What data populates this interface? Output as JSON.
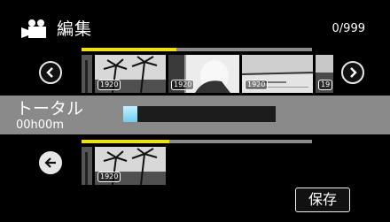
{
  "header": {
    "icon": "movie-camera-icon",
    "title": "編集",
    "counter": "0/999"
  },
  "top_rail": {
    "progress": 0.41
  },
  "top_strip": {
    "thumbnails": [
      {
        "badge": "1920",
        "scene": "palm-trees"
      },
      {
        "badge": "1920",
        "scene": "person"
      },
      {
        "badge": "1920",
        "scene": "lake"
      },
      {
        "badge": "19",
        "scene": "partial"
      }
    ]
  },
  "nav": {
    "prev_icon": "chevron-left-icon",
    "next_icon": "chevron-right-icon"
  },
  "total": {
    "label": "トータル",
    "time": "00h00m",
    "marker_fill": 0.0
  },
  "bottom_rail": {
    "progress": 0.38
  },
  "bottom_strip": {
    "back_icon": "back-arrow-icon",
    "thumbnails": [
      {
        "badge": "1920",
        "scene": "palm-trees"
      }
    ]
  },
  "actions": {
    "save_label": "保存"
  },
  "colors": {
    "accent_yellow": "#f0e010",
    "rail_gray": "#8c8c8c",
    "band_gray": "#8a8a8a",
    "marker_blue": "#6fcdf0"
  }
}
